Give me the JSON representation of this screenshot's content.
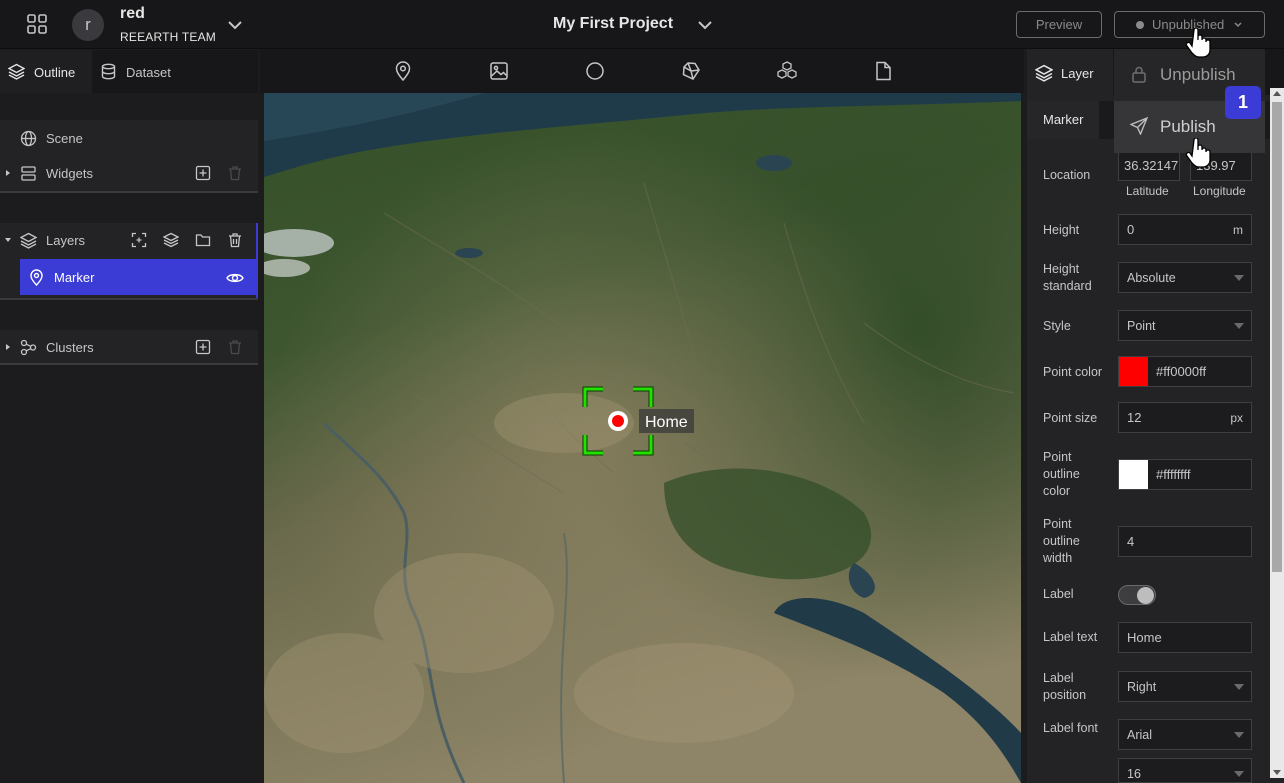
{
  "header": {
    "user_initial": "r",
    "user_name": "red",
    "team_name": "REEARTH TEAM",
    "project_title": "My First Project",
    "preview_label": "Preview",
    "publish_status_label": "Unpublished"
  },
  "publish_menu": {
    "items": [
      {
        "label": "Unpublish",
        "icon": "lock-icon"
      },
      {
        "label": "Publish",
        "icon": "send-icon"
      }
    ],
    "step_badge": "1"
  },
  "left_panel": {
    "tabs": [
      {
        "label": "Outline",
        "icon": "layers-icon"
      },
      {
        "label": "Dataset",
        "icon": "database-icon"
      }
    ],
    "scene_label": "Scene",
    "widgets_label": "Widgets",
    "layers_label": "Layers",
    "selected_layer": "Marker",
    "clusters_label": "Clusters"
  },
  "toolbar": {
    "tools": [
      "marker-tool-icon",
      "image-tool-icon",
      "circle-tool-icon",
      "box-tool-icon",
      "cluster-3d-icon",
      "file-tool-icon"
    ]
  },
  "map": {
    "marker_label": "Home",
    "marker_color": "#ff0000",
    "selection_color": "#22e000"
  },
  "right_panel": {
    "tab_label": "Layer",
    "subtab_label": "Marker",
    "fields": {
      "location_label": "Location",
      "latitude_value": "36.32147",
      "longitude_value": "139.97",
      "latitude_label": "Latitude",
      "longitude_label": "Longitude",
      "height_label": "Height",
      "height_value": "0",
      "height_unit": "m",
      "height_standard_label_1": "Height",
      "height_standard_label_2": "standard",
      "height_standard_value": "Absolute",
      "style_label": "Style",
      "style_value": "Point",
      "point_color_label": "Point color",
      "point_color_value": "#ff0000ff",
      "point_color_swatch": "#ff0000",
      "point_size_label": "Point size",
      "point_size_value": "12",
      "point_size_unit": "px",
      "outline_color_label_1": "Point",
      "outline_color_label_2": "outline",
      "outline_color_label_3": "color",
      "outline_color_value": "#ffffffff",
      "outline_color_swatch": "#ffffff",
      "outline_width_label_1": "Point",
      "outline_width_label_2": "outline",
      "outline_width_label_3": "width",
      "outline_width_value": "4",
      "label_label": "Label",
      "label_text_label": "Label text",
      "label_text_value": "Home",
      "label_position_label_1": "Label",
      "label_position_label_2": "position",
      "label_position_value": "Right",
      "label_font_label": "Label font",
      "label_font_value": "Arial",
      "label_font_size_value": "16"
    }
  },
  "colors": {
    "accent": "#3b3bd6",
    "background": "#171618",
    "panel": "#232326"
  }
}
